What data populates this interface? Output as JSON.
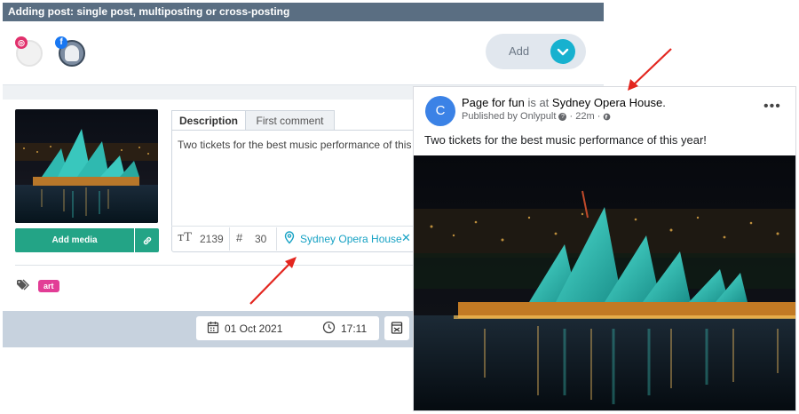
{
  "composer": {
    "title": "Adding post: single post, multiposting or cross-posting",
    "accounts": [
      {
        "network": "instagram",
        "badge": "◎"
      },
      {
        "network": "facebook",
        "badge": "f"
      }
    ],
    "add_button": "Add",
    "tabs": [
      "Description",
      "First comment"
    ],
    "description_text": "Two tickets for the best music performance of this year!",
    "char_count": "2139",
    "hashtag_count": "30",
    "location": "Sydney Opera House",
    "media_button": "Add media",
    "tags": [
      "art"
    ],
    "date": "01 Oct 2021",
    "time": "17:11"
  },
  "preview": {
    "avatar_letter": "C",
    "page_name": "Page for fun",
    "is_at": " is at ",
    "place": "Sydney Opera House",
    "period": ".",
    "published_by": "Published by Onlypult",
    "time_ago": "22m",
    "post_text": "Two tickets for the best music performance of this year!"
  },
  "colors": {
    "title_bar": "#5a6e82",
    "accent_teal": "#17b1cf",
    "media_green": "#23a486",
    "tag_pink": "#e23d96",
    "arrow_red": "#e3261f"
  }
}
